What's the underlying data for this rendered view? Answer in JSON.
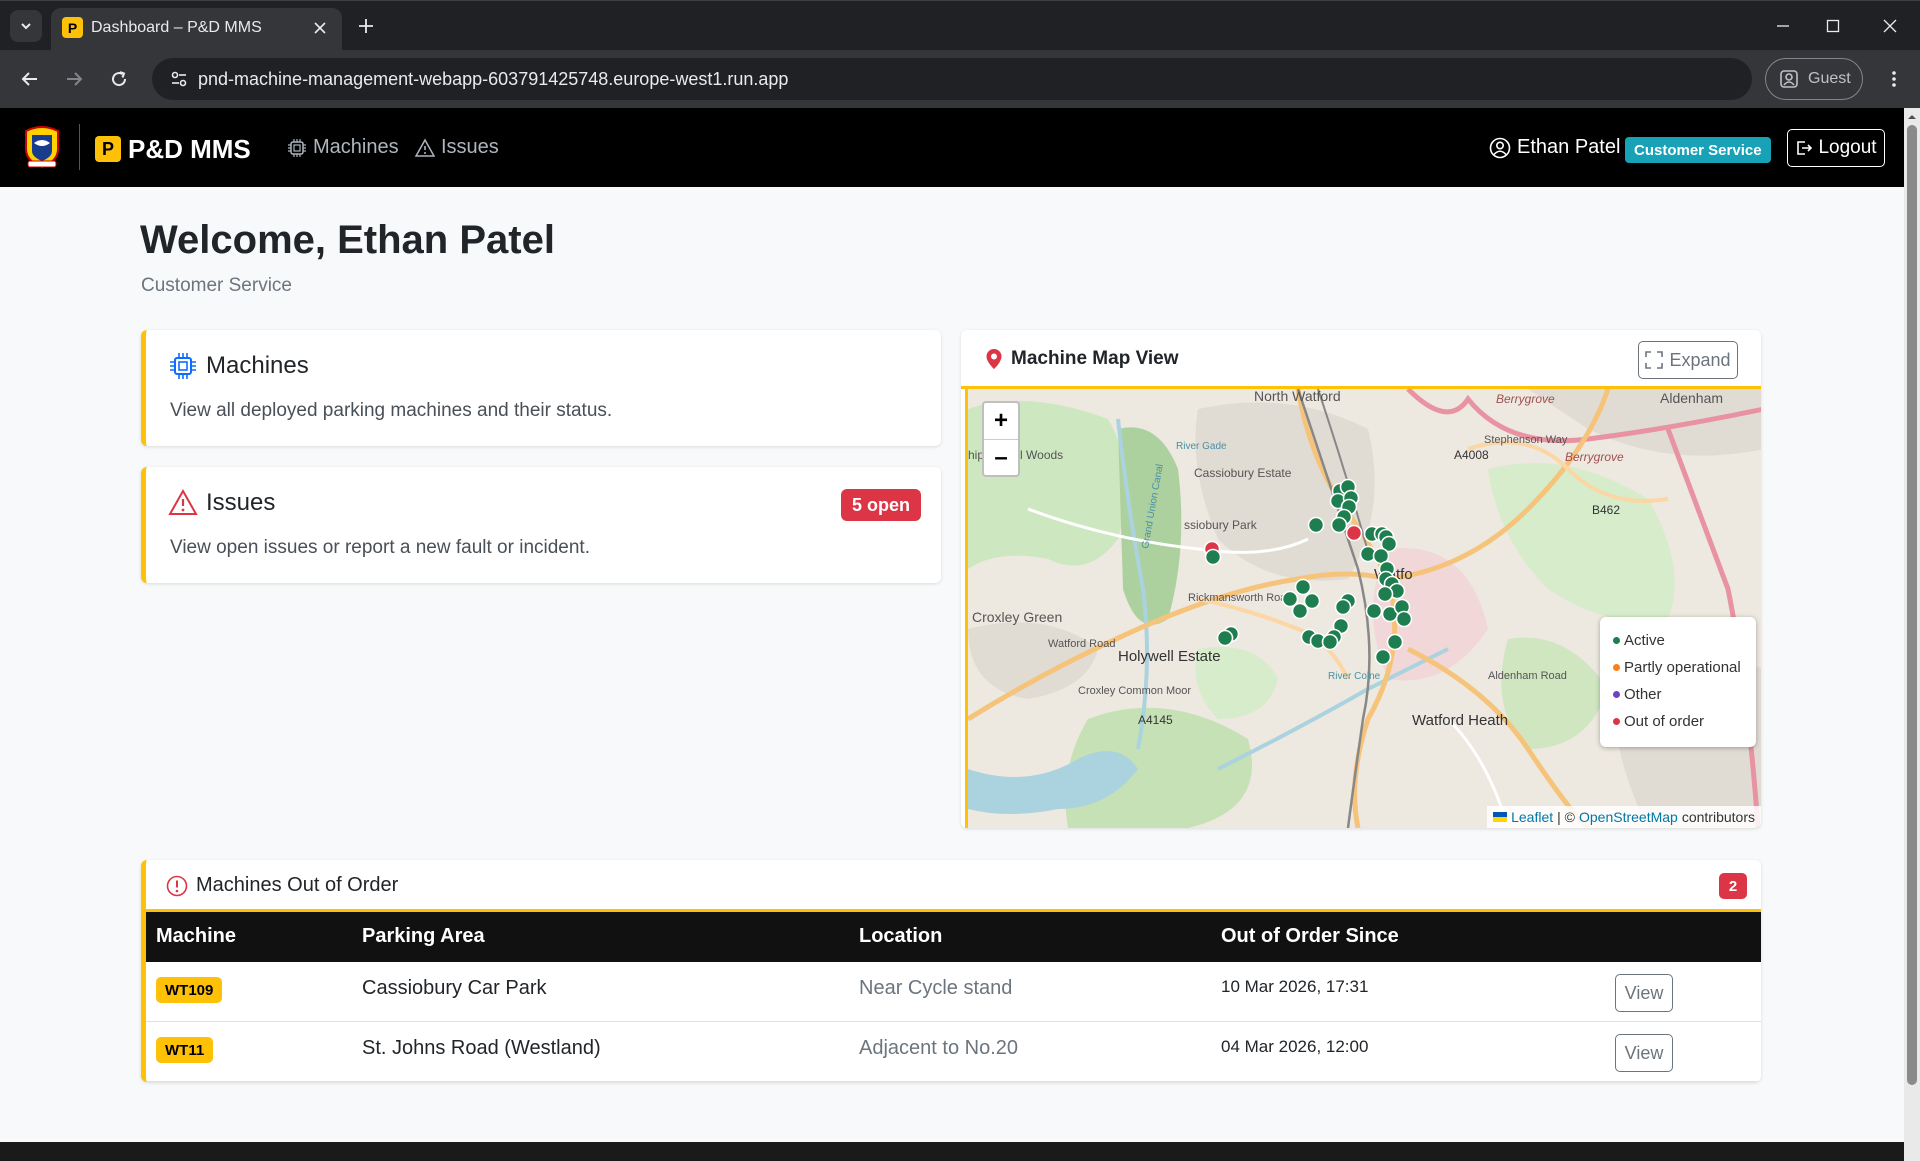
{
  "browser": {
    "tab_title": "Dashboard – P&D MMS",
    "tab_favicon": "P",
    "url": "pnd-machine-management-webapp-603791425748.europe-west1.run.app",
    "profile_label": "Guest"
  },
  "navbar": {
    "brand_icon": "P",
    "brand": "P&D MMS",
    "links": [
      {
        "label": "Machines",
        "icon": "chip-icon"
      },
      {
        "label": "Issues",
        "icon": "warning-icon"
      }
    ],
    "user_name": "Ethan Patel",
    "user_role": "Customer Service",
    "logout_label": "Logout"
  },
  "header": {
    "title": "Welcome, Ethan Patel",
    "subtitle": "Customer Service"
  },
  "cards": {
    "machines": {
      "title": "Machines",
      "text": "View all deployed parking machines and their status."
    },
    "issues": {
      "title": "Issues",
      "text": "View open issues or report a new fault or incident.",
      "badge": "5 open"
    }
  },
  "map": {
    "title": "Machine Map View",
    "expand_label": "Expand",
    "zoom_in": "+",
    "zoom_out": "–",
    "place_labels": [
      "North Watford",
      "Berrygrove",
      "Aldenham",
      "Cassiobury Estate",
      "A4008",
      "Stephenson Way",
      "Berrygrove",
      "B462",
      "ssiobury Park",
      "Watfo",
      "Rickmansworth Road",
      "Croxley Green",
      "Watford Road",
      "Holywell Estate",
      "Croxley Common Moor",
      "A4145",
      "Aldenham Road",
      "Watford Heath",
      "Grand Union Canal",
      "River Colne",
      "River Gade",
      "hippendell Woods"
    ],
    "legend": [
      {
        "label": "Active",
        "color": "#1e7e50"
      },
      {
        "label": "Partly operational",
        "color": "#fd7e14"
      },
      {
        "label": "Other",
        "color": "#6f42c1"
      },
      {
        "label": "Out of order",
        "color": "#dc3545"
      }
    ],
    "attribution": {
      "leaflet": "Leaflet",
      "sep": "| ©",
      "osm": "OpenStreetMap",
      "suffix": "contributors"
    },
    "marker_colors": {
      "active": "#1e7e50",
      "out_of_order": "#dc3545"
    }
  },
  "out_of_order": {
    "title": "Machines Out of Order",
    "count": "2",
    "columns": [
      "Machine",
      "Parking Area",
      "Location",
      "Out of Order Since"
    ],
    "rows": [
      {
        "machine": "WT109",
        "area": "Cassiobury Car Park",
        "location": "Near Cycle stand",
        "since": "10 Mar 2026, 17:31",
        "action": "View"
      },
      {
        "machine": "WT11",
        "area": "St. Johns Road (Westland)",
        "location": "Adjacent to No.20",
        "since": "04 Mar 2026, 12:00",
        "action": "View"
      }
    ]
  }
}
